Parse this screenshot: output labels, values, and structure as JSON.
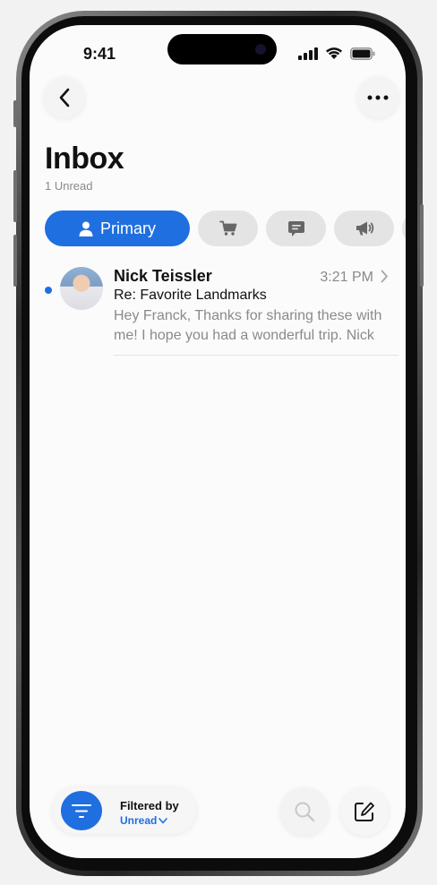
{
  "status": {
    "time": "9:41"
  },
  "header": {
    "title": "Inbox",
    "unread_count": "1 Unread"
  },
  "tabs": [
    {
      "label": "Primary",
      "icon": "person-icon",
      "selected": true
    },
    {
      "icon": "cart-icon"
    },
    {
      "icon": "message-icon"
    },
    {
      "icon": "megaphone-icon"
    }
  ],
  "messages": [
    {
      "sender": "Nick Teissler",
      "time": "3:21 PM",
      "subject": "Re: Favorite Landmarks",
      "preview": "Hey Franck, Thanks for sharing these with me! I hope you had a wonderful trip. Nick",
      "unread": true
    }
  ],
  "bottom_bar": {
    "filter_title": "Filtered by",
    "filter_value": "Unread"
  },
  "colors": {
    "accent": "#1f6fe0",
    "secondary_text": "#8a8a8a",
    "chip_bg": "#e4e4e4"
  }
}
